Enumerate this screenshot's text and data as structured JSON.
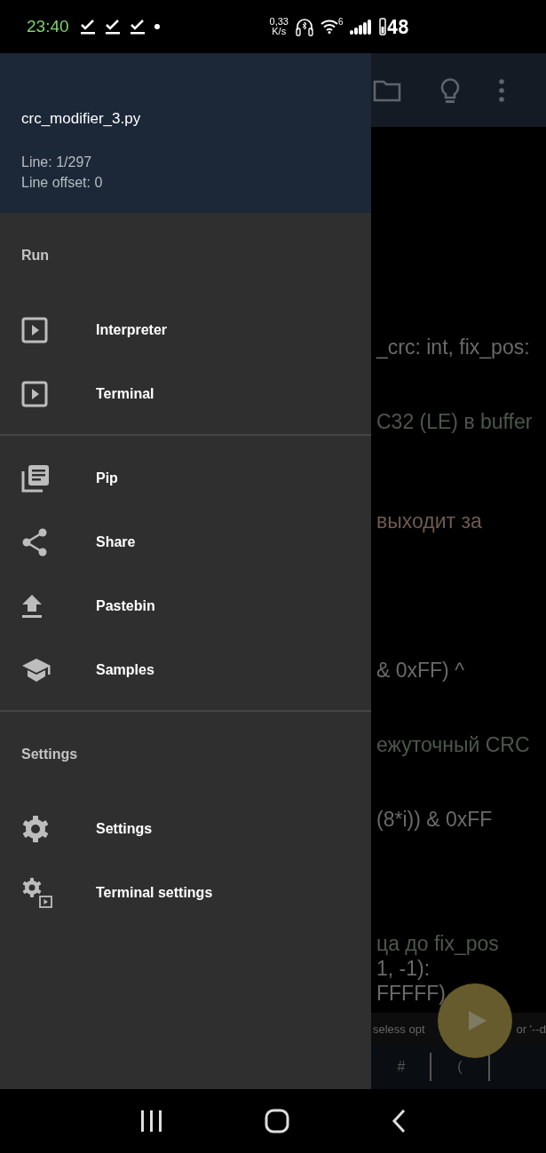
{
  "status_bar": {
    "time": "23:40",
    "net_speed": "0,33",
    "net_unit": "K/s",
    "wifi_badge": "6",
    "battery": "48"
  },
  "editor": {
    "code_lines": [
      {
        "text": "_crc: int, fix_pos:",
        "kind": "code"
      },
      {
        "text": "C32 (LE) в buffer",
        "kind": "comment"
      },
      {
        "text": "выходит за",
        "kind": "string"
      },
      {
        "text": "& 0xFF) ^",
        "kind": "code"
      },
      {
        "text": "ежуточный CRC",
        "kind": "comment"
      },
      {
        "text": "(8*i)) & 0xFF",
        "kind": "code"
      },
      {
        "text": "ца до fix_pos",
        "kind": "comment"
      },
      {
        "text": "1, -1):",
        "kind": "code"
      },
      {
        "text": "FFFFF)",
        "kind": "code"
      }
    ],
    "message_left": "seless opt",
    "message_right": "or '--d",
    "keys": [
      "#",
      "("
    ]
  },
  "drawer": {
    "file_name": "crc_modifier_3.py",
    "line": "Line: 1/297",
    "line_offset": "Line offset: 0",
    "sections": [
      {
        "title": "Run",
        "items": [
          {
            "label": "Interpreter"
          },
          {
            "label": "Terminal"
          }
        ]
      },
      {
        "items": [
          {
            "label": "Pip"
          },
          {
            "label": "Share"
          },
          {
            "label": "Pastebin"
          },
          {
            "label": "Samples"
          }
        ]
      },
      {
        "title": "Settings",
        "items": [
          {
            "label": "Settings"
          },
          {
            "label": "Terminal settings"
          }
        ]
      }
    ]
  }
}
